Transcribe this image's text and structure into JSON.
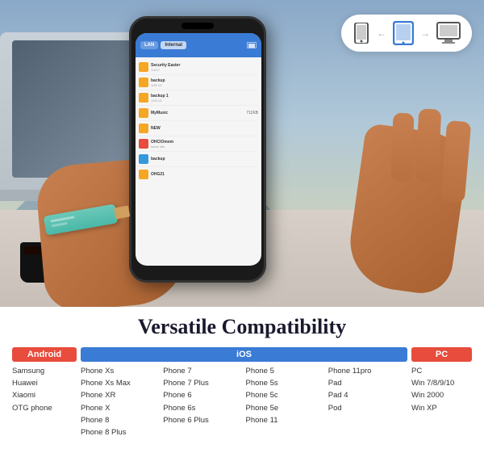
{
  "image_section": {
    "alt": "Hand holding phone with USB drive connected to laptop"
  },
  "device_icons": {
    "phone_icon": "📱",
    "tablet_icon": "📱",
    "monitor_icon": "🖥"
  },
  "phone_screen": {
    "tab1": "LAN",
    "tab2": "Internal",
    "files": [
      {
        "name": "Security Easter",
        "type": "folder",
        "date": "7/1/17",
        "size": ""
      },
      {
        "name": "backup",
        "type": "folder",
        "date": "1/29 13",
        "size": ""
      },
      {
        "name": "backup 1",
        "type": "folder",
        "date": "1/29 13",
        "size": ""
      },
      {
        "name": "MyMusic",
        "type": "folder",
        "date": "",
        "size": "711KB"
      },
      {
        "name": "NEW",
        "type": "folder",
        "date": "",
        "size": ""
      },
      {
        "name": "OHClOmem",
        "type": "img",
        "date": "",
        "size": ""
      },
      {
        "name": "backup",
        "type": "doc",
        "date": "",
        "size": ""
      },
      {
        "name": "OHG21",
        "type": "folder",
        "date": "",
        "size": ""
      }
    ]
  },
  "compat": {
    "title": "Versatile Compatibility",
    "android": {
      "header": "Android",
      "items": [
        "Samsung",
        "Huawei",
        "Xiaomi",
        "OTG phone"
      ]
    },
    "ios": {
      "header": "iOS",
      "columns": [
        {
          "items": [
            "Phone Xs",
            "Phone Xs Max",
            "Phone XR",
            "Phone X",
            "Phone 8",
            "Phone 8 Plus"
          ]
        },
        {
          "items": [
            "Phone 7",
            "Phone 7 Plus",
            "Phone 6",
            "Phone 6s",
            "Phone 6 Plus"
          ]
        },
        {
          "items": [
            "Phone 5",
            "Phone 5s",
            "Phone 5c",
            "Phone 5e",
            "Phone 11"
          ]
        },
        {
          "items": [
            "Phone 11pro",
            "Pad",
            "Pad 4",
            "Pod"
          ]
        }
      ]
    },
    "pc": {
      "header": "PC",
      "items": [
        "PC",
        "Win 7/8/9/10",
        "Win 2000",
        "Win XP"
      ]
    }
  }
}
